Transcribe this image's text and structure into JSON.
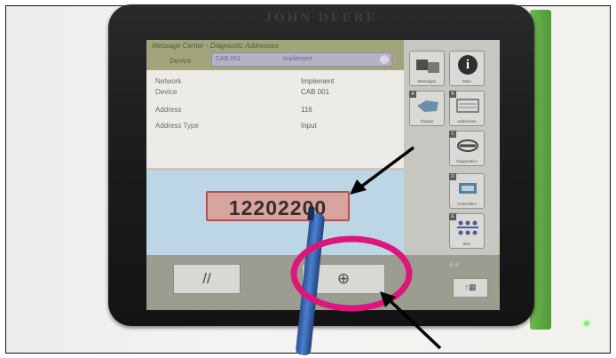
{
  "photo": {
    "brand": "JOHN DEERE"
  },
  "screen": {
    "title": "Message Center - Diagnostic Addresses",
    "device_label": "Device",
    "device_value_a": "CAB 001",
    "device_value_b": "Implement",
    "rows": [
      {
        "label": "Network",
        "value": "Implement"
      },
      {
        "label": "Device",
        "value": "CAB 001"
      },
      {
        "label": "Address",
        "value": "116"
      },
      {
        "label": "Address Type",
        "value": "Input"
      }
    ],
    "address_value": "12202200",
    "clear_symbol": "//",
    "enter_symbol": "⊕"
  },
  "softkeys": [
    {
      "label": "Messages",
      "icon": "messages-icon"
    },
    {
      "label": "Main",
      "icon": "info-icon"
    },
    {
      "label": "Display",
      "icon": "display-icon"
    },
    {
      "label": "Addresses",
      "icon": "addresses-icon"
    },
    {
      "label": "Diagnostics",
      "icon": "wrench-icon"
    },
    {
      "label": "Controllers",
      "icon": "controller-icon"
    },
    {
      "label": "Bus",
      "icon": "network-icon"
    }
  ],
  "side_bottom": {
    "page_text": "6 of",
    "scroll_symbol": "↑▦"
  },
  "annotations": {
    "arrow_color": "#000000",
    "circle_color": "#e0157c"
  }
}
